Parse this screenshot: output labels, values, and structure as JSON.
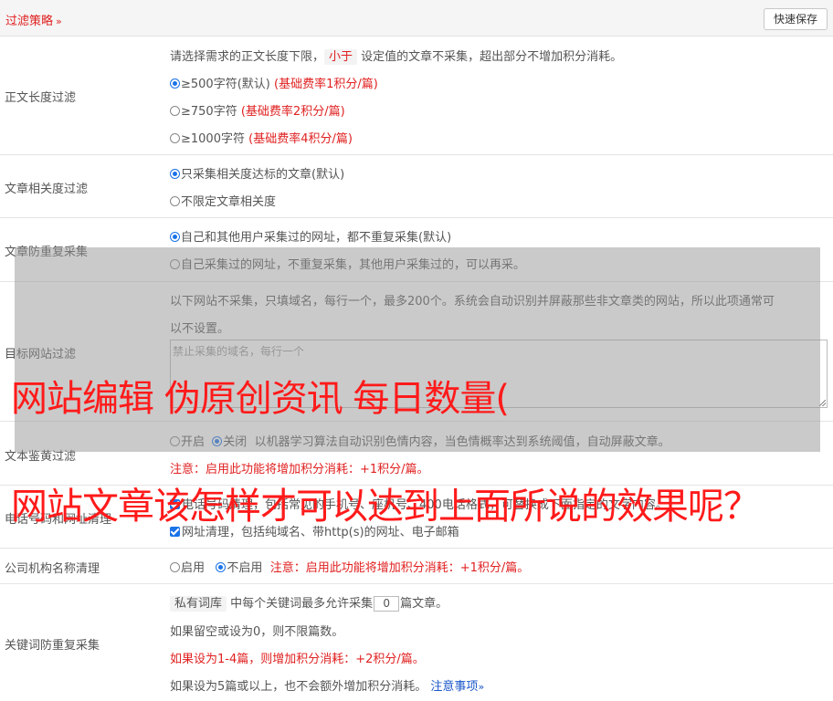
{
  "topbar": {
    "title": "过滤策略",
    "save_label": "快速保存"
  },
  "length_filter": {
    "label": "正文长度过滤",
    "desc_pre": "请选择需求的正文长度下限，",
    "desc_tag": "小于",
    "desc_post": "设定值的文章不采集，超出部分不增加积分消耗。",
    "opt1": "≥500字符(默认)",
    "opt1_note": "(基础费率1积分/篇)",
    "opt2": "≥750字符",
    "opt2_note": "(基础费率2积分/篇)",
    "opt3": "≥1000字符",
    "opt3_note": "(基础费率4积分/篇)"
  },
  "relevance": {
    "label": "文章相关度过滤",
    "opt1": "只采集相关度达标的文章(默认)",
    "opt2": "不限定文章相关度"
  },
  "dedupe": {
    "label": "文章防重复采集",
    "opt1": "自己和其他用户采集过的网址，都不重复采集(默认)",
    "opt2": "自己采集过的网址，不重复采集，其他用户采集过的，可以再采。"
  },
  "target_site": {
    "label": "目标网站过滤",
    "desc1": "以下网站不采集，只填域名，每行一个，最多200个。系统会自动识别并屏蔽那些非文章类的网站，所以此项通常可",
    "desc2": "以不设置。",
    "placeholder": "禁止采集的域名，每行一个"
  },
  "porn": {
    "label": "文本鉴黄过滤",
    "on": "开启",
    "off": "关闭",
    "desc": "以机器学习算法自动识别色情内容，当色情概率达到系统阈值，自动屏蔽文章。",
    "note": "注意：启用此功能将增加积分消耗：+1积分/篇。"
  },
  "contact": {
    "label": "电话号码和网址清理",
    "opt1": "电话号码清理，包括常见的手机号、座机号、400电话格式，可替换成下面指定的文字内容。",
    "opt2": "网址清理，包括纯域名、带http(s)的网址、电子邮箱"
  },
  "company": {
    "label": "公司机构名称清理",
    "on": "启用",
    "off": "不启用",
    "note": "注意：启用此功能将增加积分消耗：+1积分/篇。"
  },
  "keyword": {
    "label": "关键词防重复采集",
    "tag": "私有词库",
    "line1_pre": "中每个关键词最多允许采集",
    "count": "0",
    "line1_post": "篇文章。",
    "line2": "如果留空或设为0，则不限篇数。",
    "line3": "如果设为1-4篇，则增加积分消耗：+2积分/篇。",
    "line4": "如果设为5篇或以上，也不会额外增加积分消耗。",
    "link": "注意事项"
  },
  "overlay": {
    "line1": "网站编辑 伪原创资讯 每日数量(",
    "line2": "网站文章该怎样才可以达到上面所说的效果呢？"
  },
  "colors": {
    "accent_red": "#e02020",
    "link_blue": "#1a56c8",
    "radio_blue": "#1a73e8"
  }
}
